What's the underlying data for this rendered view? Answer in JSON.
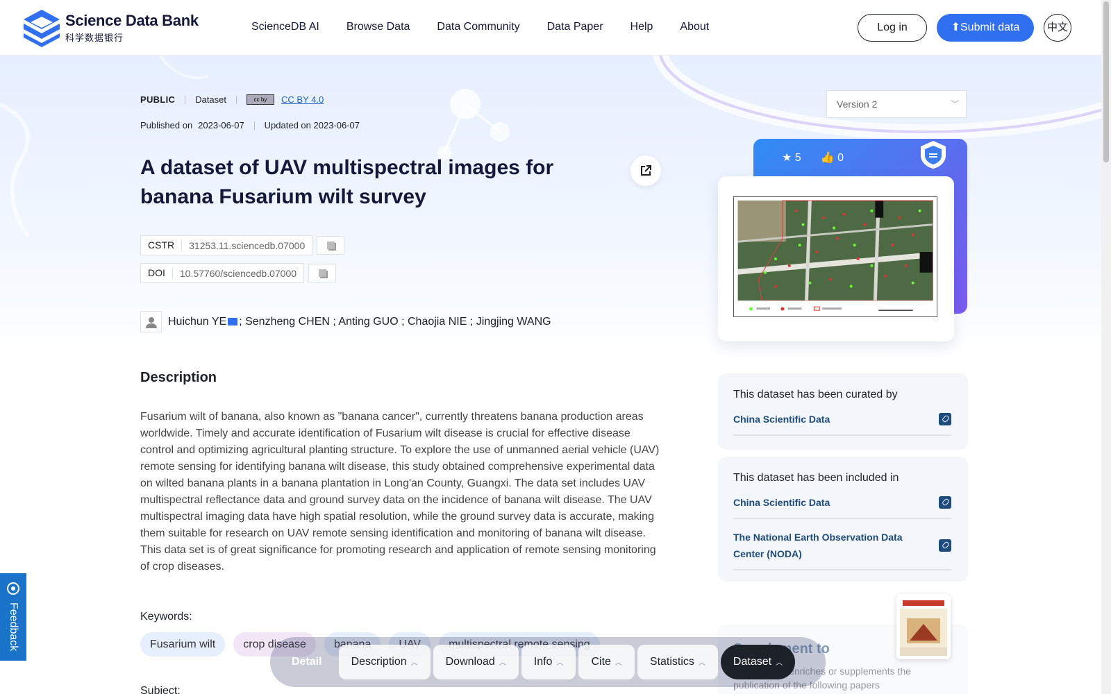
{
  "brand": {
    "name_en": "Science Data Bank",
    "name_cn": "科学数据银行"
  },
  "nav": {
    "items": [
      "ScienceDB AI",
      "Browse Data",
      "Data Community",
      "Data Paper",
      "Help",
      "About"
    ]
  },
  "header": {
    "login_label": "Log in",
    "submit_label": "Submit data",
    "lang_label": "中文"
  },
  "version_select": {
    "value": "Version 2"
  },
  "dataset": {
    "access": "PUBLIC",
    "type": "Dataset",
    "license_badge": "cc by",
    "license": "CC BY 4.0",
    "published_label": "Published on",
    "published_date": "2023-06-07",
    "updated_text": "Updated on 2023-06-07",
    "title": "A dataset of UAV multispectral images for banana Fusarium wilt survey",
    "cstr_key": "CSTR",
    "cstr_value": "31253.11.sciencedb.07000",
    "doi_key": "DOI",
    "doi_value": "10.57760/sciencedb.07000",
    "first_author": "Huichun YE",
    "other_authors": "; Senzheng CHEN ; Anting GUO ; Chaojia NIE ; Jingjing WANG"
  },
  "description": {
    "heading": "Description",
    "text": "Fusarium wilt of banana, also known as \"banana cancer\", currently threatens banana production areas worldwide. Timely and accurate identification of Fusarium wilt disease is crucial for effective disease control and optimizing agricultural planting structure. To explore the use of unmanned aerial vehicle (UAV) remote sensing for identifying banana wilt disease, this study obtained comprehensive experimental data on wilted banana plants in a banana plantation in Long'an County, Guangxi. The data set includes UAV multispectral reflectance data and ground survey data on the incidence of banana wilt disease. The UAV multispectral imaging data have high spatial resolution, while the ground survey data is accurate, making them suitable for research on UAV remote sensing identification and monitoring of banana wilt disease. This data set is of great significance for promoting research and application of remote sensing monitoring of crop diseases."
  },
  "keywords": {
    "label": "Keywords:",
    "items": [
      "Fusarium wilt",
      "crop disease",
      "banana",
      "UAV",
      "multispectral remote sensing"
    ]
  },
  "subject_label": "Subject:",
  "stats": {
    "stars": "5",
    "likes": "0"
  },
  "curated": {
    "title": "This dataset has been curated by",
    "links": [
      "China Scientific Data"
    ]
  },
  "included": {
    "title": "This dataset has been included in",
    "links": [
      "China Scientific Data",
      "The National Earth Observation Data Center (NODA)"
    ]
  },
  "supplement": {
    "title": "Supplement to",
    "text": "This dataset enriches or supplements the publication of the following papers"
  },
  "feedback_label": "Feedback",
  "bottom_bar": {
    "detail_label": "Detail",
    "tabs": [
      "Description",
      "Download",
      "Info",
      "Cite",
      "Statistics",
      "Dataset"
    ],
    "active_tab": "Dataset"
  }
}
